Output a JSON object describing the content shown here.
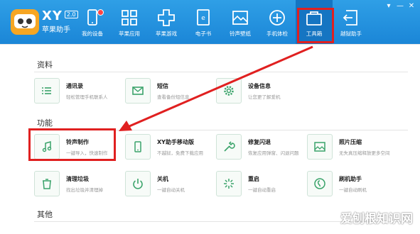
{
  "app": {
    "logo_text": "XY",
    "version": "2.0",
    "name": "苹果助手"
  },
  "nav": [
    {
      "label": "我的设备",
      "icon": "device-icon"
    },
    {
      "label": "苹果应用",
      "icon": "apps-grid-icon"
    },
    {
      "label": "苹果游戏",
      "icon": "game-pad-icon"
    },
    {
      "label": "电子书",
      "icon": "ebook-icon"
    },
    {
      "label": "铃声壁纸",
      "icon": "wallpaper-icon"
    },
    {
      "label": "手机体检",
      "icon": "checkup-icon"
    },
    {
      "label": "工具箱",
      "icon": "toolbox-icon"
    },
    {
      "label": "越狱助手",
      "icon": "jailbreak-icon"
    }
  ],
  "window_controls": [
    "▾",
    "—",
    "✕"
  ],
  "sections": {
    "data": "资料",
    "features": "功能",
    "other": "其他"
  },
  "data_items": [
    {
      "title": "通讯录",
      "desc": "轻松管理手机联系人",
      "icon": "contacts-list-icon"
    },
    {
      "title": "短信",
      "desc": "查看备份短信息",
      "icon": "sms-icon"
    },
    {
      "title": "设备信息",
      "desc": "让您更了解爱机",
      "icon": "gear-icon"
    }
  ],
  "feature_items": [
    {
      "title": "铃声制作",
      "desc": "一键导入，快速制作",
      "icon": "music-note-icon"
    },
    {
      "title": "XY助手移动版",
      "desc": "不越狱，免费下载应用",
      "icon": "mobile-icon"
    },
    {
      "title": "修复闪退",
      "desc": "恢复应用弹窗、闪退问题",
      "icon": "wrench-icon"
    },
    {
      "title": "照片压缩",
      "desc": "无失真压缩释放更多空间",
      "icon": "photo-icon"
    },
    {
      "title": "清理垃圾",
      "desc": "找出垃圾并清理掉",
      "icon": "trash-icon"
    },
    {
      "title": "关机",
      "desc": "一键自动关机",
      "icon": "power-icon"
    },
    {
      "title": "重启",
      "desc": "一键自动重启",
      "icon": "restart-icon"
    },
    {
      "title": "刷机助手",
      "desc": "一键自动刷机",
      "icon": "flash-icon"
    }
  ],
  "watermark": "爱刨根知识网",
  "colors": {
    "topbar": "#1b86d7",
    "highlight": "#e02020",
    "tile_icon": "#3aa36a"
  }
}
